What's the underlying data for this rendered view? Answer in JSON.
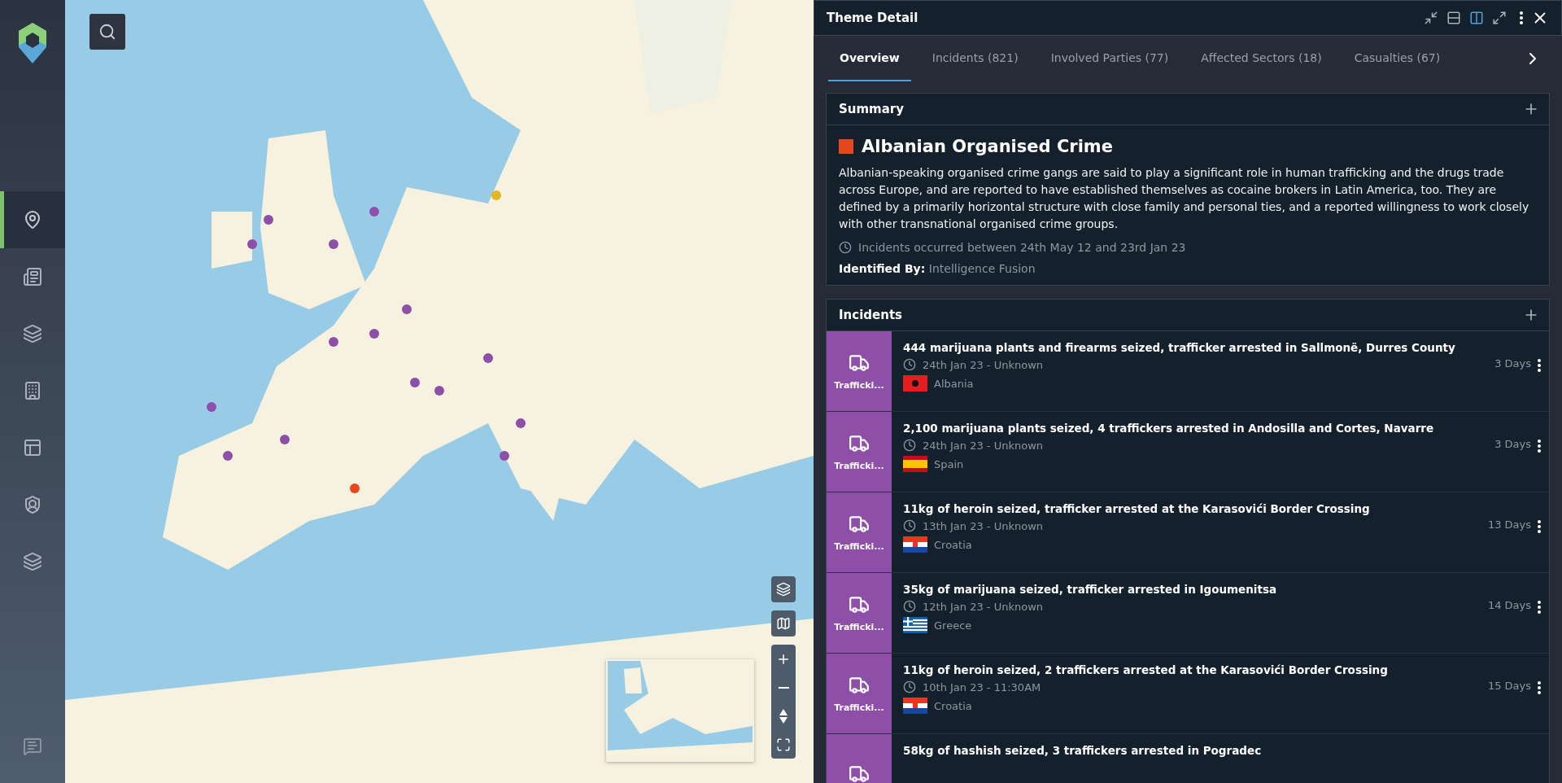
{
  "sidebar": {
    "nav_items": [
      {
        "selected": true
      },
      {
        "selected": false
      },
      {
        "selected": false
      },
      {
        "selected": false
      },
      {
        "selected": false
      },
      {
        "selected": false
      },
      {
        "selected": false
      }
    ]
  },
  "map": {
    "kind": "picture"
  },
  "panel": {
    "title": "Theme Detail",
    "view_modes": [
      {
        "selected": false
      },
      {
        "selected": false
      },
      {
        "selected": true
      },
      {
        "selected": false
      }
    ],
    "tabs": [
      {
        "label": "Overview",
        "selected": true
      },
      {
        "label": "Incidents (821)",
        "selected": false
      },
      {
        "label": "Involved Parties (77)",
        "selected": false
      },
      {
        "label": "Affected Sectors (18)",
        "selected": false
      },
      {
        "label": "Casualties (67)",
        "selected": false
      }
    ],
    "summary": {
      "heading": "Summary",
      "theme_name": "Albanian Organised Crime",
      "description": "Albanian-speaking organised crime gangs are said to play a significant role in human trafficking and the drugs trade across Europe, and are reported to have established themselves as cocaine brokers in Latin America, too. They are defined by a primarily horizontal structure with close family and personal ties, and a reported willingness to work closely with other transnational organised crime groups.",
      "date_range": "Incidents occurred between 24th May 12 and 23rd Jan 23",
      "identified_by_label": "Identified By:",
      "identified_by": "Intelligence Fusion"
    },
    "incidents": {
      "heading": "Incidents",
      "items": [
        {
          "category": "Trafficki...",
          "color": "#8e4fa8",
          "title": "444 marijuana plants and firearms seized, trafficker arrested in Sallmonë, Durres County",
          "date": "24th Jan 23 - Unknown",
          "kind": "albania",
          "country": "Albania",
          "age": "3 Days"
        },
        {
          "category": "Trafficki...",
          "color": "#8e4fa8",
          "title": "2,100 marijuana plants seized, 4 traffickers arrested in Andosilla and Cortes, Navarre",
          "date": "24th Jan 23 - Unknown",
          "kind": "spain",
          "country": "Spain",
          "age": "3 Days"
        },
        {
          "category": "Trafficki...",
          "color": "#8e4fa8",
          "title": "11kg of heroin seized, trafficker arrested at the Karasovići Border Crossing",
          "date": "13th Jan 23 - Unknown",
          "kind": "croatia",
          "country": "Croatia",
          "age": "13 Days"
        },
        {
          "category": "Trafficki...",
          "color": "#8e4fa8",
          "title": "35kg of marijuana seized, trafficker arrested in Igoumenitsa",
          "date": "12th Jan 23 - Unknown",
          "kind": "greece",
          "country": "Greece",
          "age": "14 Days"
        },
        {
          "category": "Trafficki...",
          "color": "#8e4fa8",
          "title": "11kg of heroin seized, 2 traffickers arrested at the Karasovići Border Crossing",
          "date": "10th Jan 23 - 11:30AM",
          "kind": "croatia",
          "country": "Croatia",
          "age": "15 Days"
        },
        {
          "color": "#8e4fa8",
          "title": "58kg of hashish seized, 3 traffickers arrested in Pogradec"
        }
      ]
    }
  }
}
